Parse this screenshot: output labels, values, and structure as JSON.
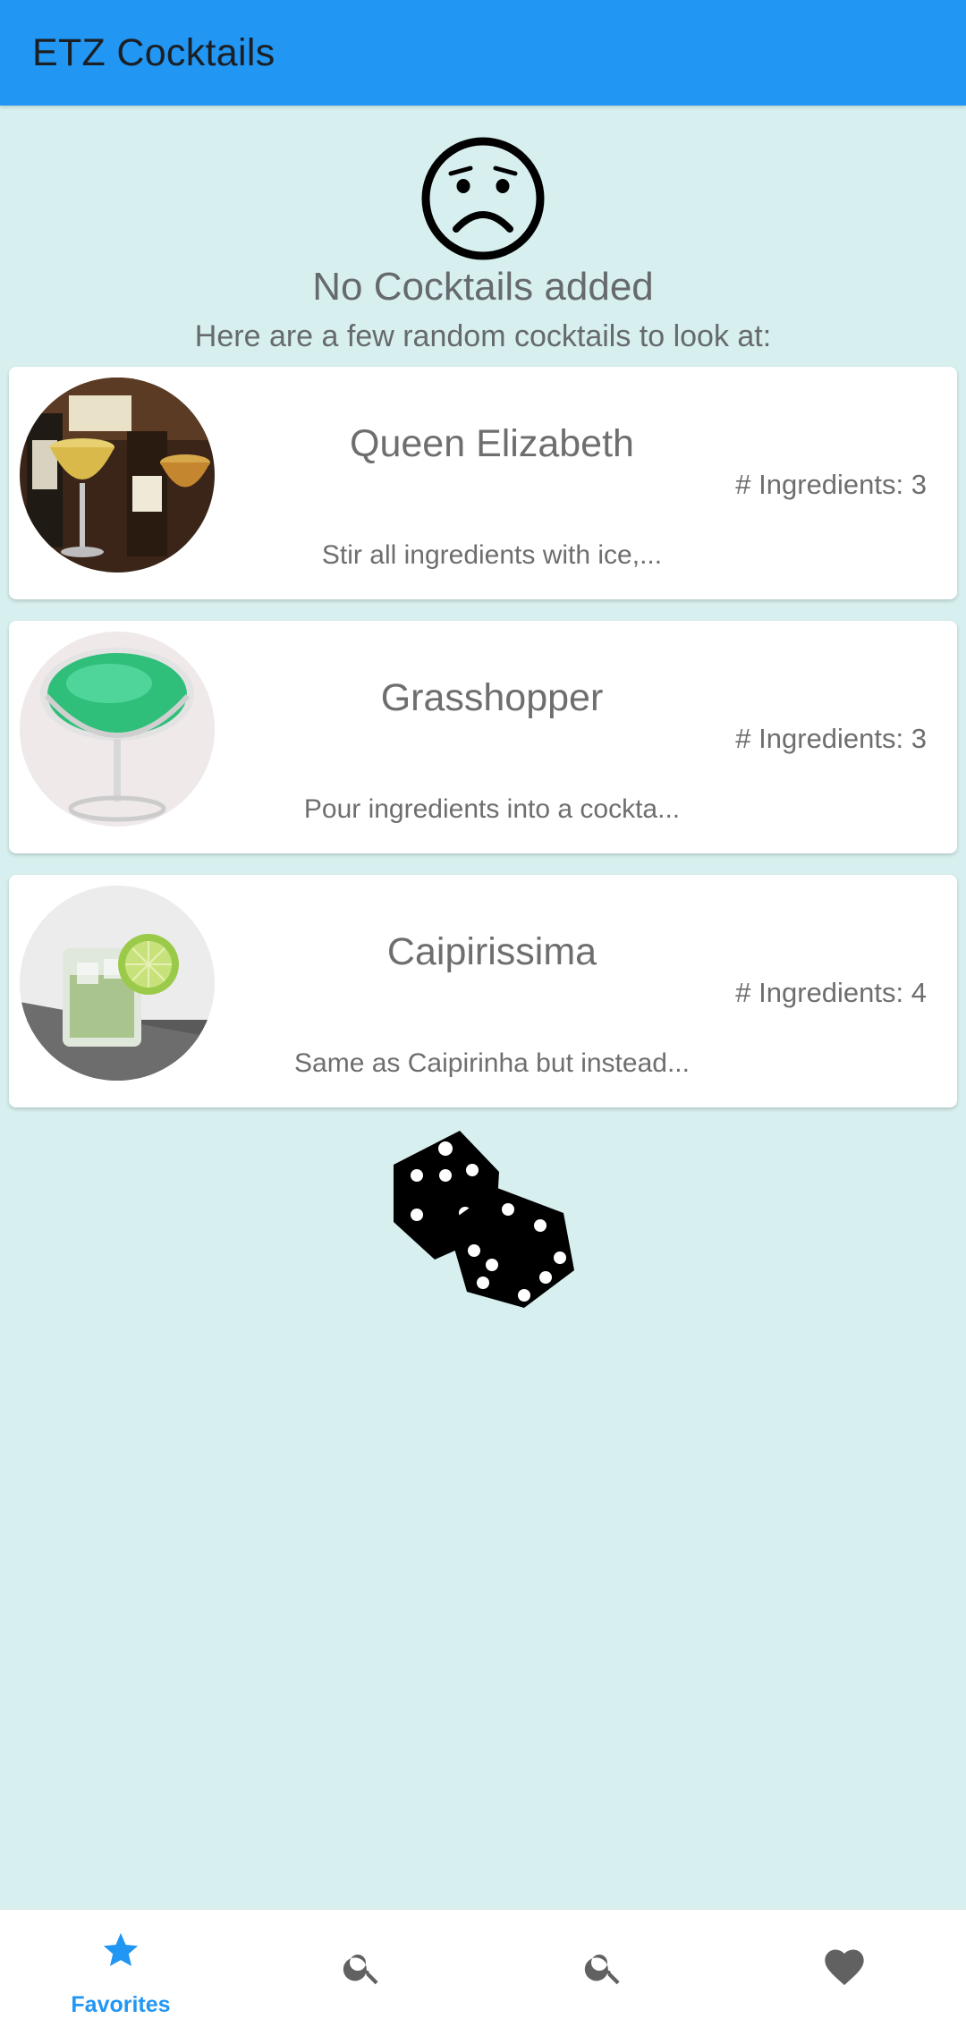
{
  "appbar": {
    "title": "ETZ Cocktails"
  },
  "empty_state": {
    "icon": "sad-face-icon",
    "title": "No Cocktails added",
    "subtitle": "Here are a few random cocktails to look at:"
  },
  "cocktails": [
    {
      "name": "Queen Elizabeth",
      "ingredients": "# Ingredients: 3",
      "description": "Stir all ingredients with ice,..."
    },
    {
      "name": "Grasshopper",
      "ingredients": "# Ingredients: 3",
      "description": "Pour ingredients into a cockta..."
    },
    {
      "name": "Caipirissima",
      "ingredients": "# Ingredients: 4",
      "description": "Same as Caipirinha but instead..."
    }
  ],
  "random_button": {
    "icon": "dice-icon"
  },
  "bottom_nav": {
    "items": [
      {
        "label": "Favorites",
        "icon": "star-icon",
        "active": true
      },
      {
        "label": "",
        "icon": "search-icon",
        "active": false
      },
      {
        "label": "",
        "icon": "search-icon",
        "active": false
      },
      {
        "label": "",
        "icon": "heart-icon",
        "active": false
      }
    ]
  },
  "colors": {
    "primary": "#2196f3",
    "background": "#d7f0ef",
    "card": "#ffffff",
    "text_muted": "#6e6e6e",
    "nav_inactive": "#616161"
  }
}
